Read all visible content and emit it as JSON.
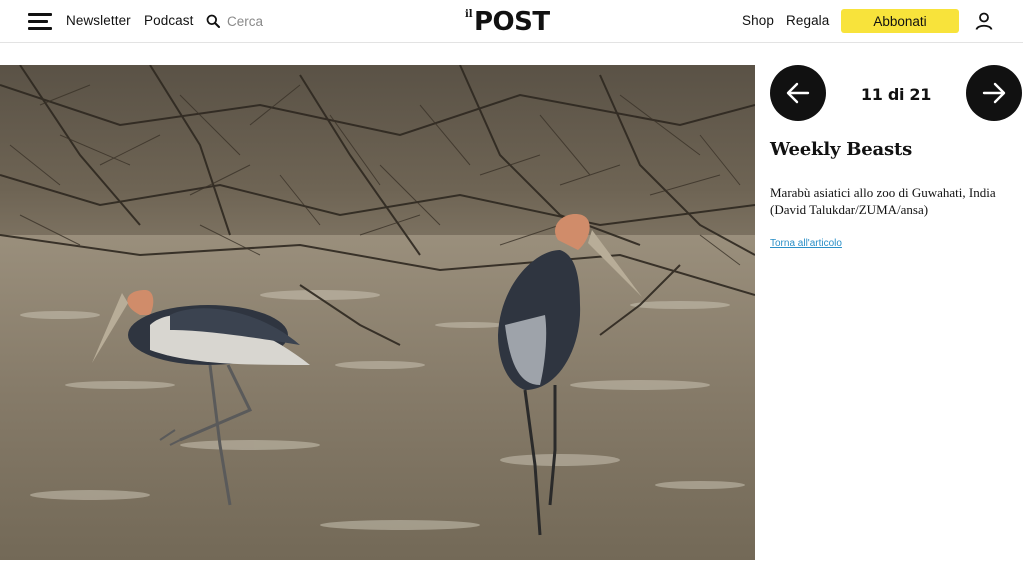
{
  "header": {
    "nav_left": [
      {
        "label": "Newsletter"
      },
      {
        "label": "Podcast"
      }
    ],
    "search": {
      "placeholder": "Cerca"
    },
    "logo": {
      "prefix": "il",
      "text": "POST"
    },
    "nav_right": [
      {
        "label": "Shop"
      },
      {
        "label": "Regala"
      }
    ],
    "subscribe_label": "Abbonati",
    "subscribe_color": "#f8e33b",
    "icons": [
      "hamburger-menu-icon",
      "search-icon",
      "user-icon"
    ]
  },
  "gallery": {
    "counter": "11 di 21",
    "current": 11,
    "total": 21,
    "title": "Weekly Beasts",
    "caption": "Marabù asiatici allo zoo di Guwahati, India (David Talukdar/ZUMA/ansa)",
    "back_link": "Torna all'articolo",
    "link_color": "#2a8fc7",
    "icons": [
      "arrow-left-icon",
      "arrow-right-icon"
    ]
  }
}
